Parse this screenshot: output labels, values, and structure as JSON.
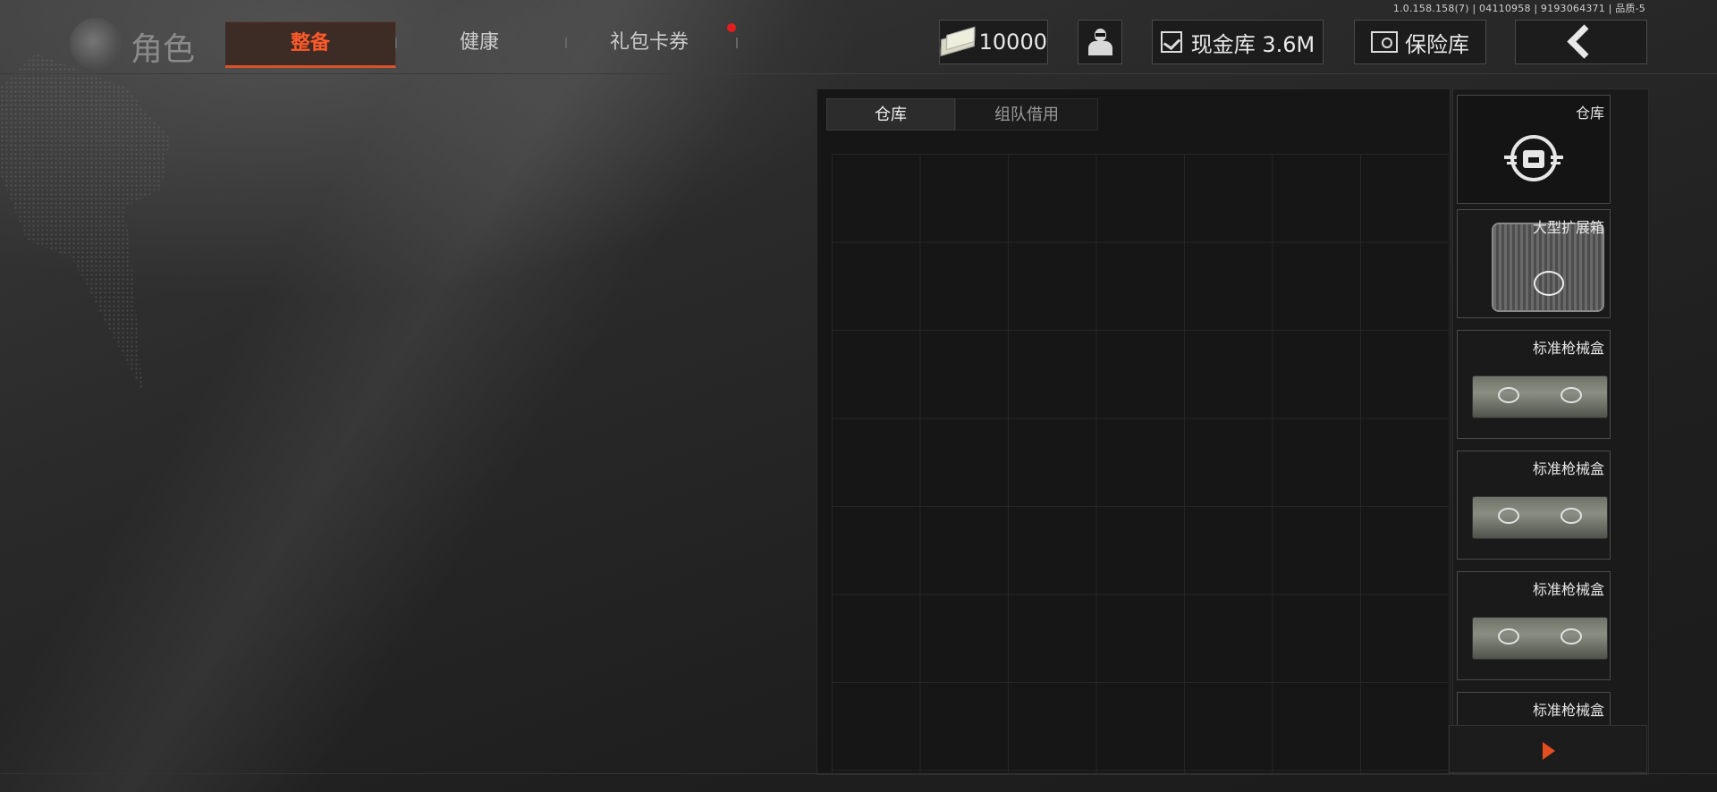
{
  "version_text": "1.0.158.158(7) | 04110958 | 9193064371 | 品质-5",
  "header": {
    "title": "角色",
    "tabs": [
      {
        "label": "整备",
        "active": true
      },
      {
        "label": "健康",
        "active": false
      },
      {
        "label": "礼包卡券",
        "active": false,
        "notification": true
      }
    ],
    "money": "10000",
    "cash_vault": "现金库 3.6M",
    "safe": "保险库",
    "icons": {
      "money": "banknote-icon",
      "agent": "agent-icon",
      "cash": "chart-icon",
      "safe": "safe-icon",
      "back": "back-chevron-icon"
    }
  },
  "storage": {
    "tabs": [
      {
        "label": "仓库",
        "active": true
      },
      {
        "label": "组队借用",
        "active": false
      }
    ]
  },
  "sidebar": {
    "items": [
      {
        "label": "仓库"
      },
      {
        "label": "大型扩展箱"
      },
      {
        "label": "标准枪械盒"
      },
      {
        "label": "标准枪械盒"
      },
      {
        "label": "标准枪械盒"
      },
      {
        "label": "标准枪械盒"
      }
    ]
  },
  "colors": {
    "accent": "#ff5a2a",
    "notification": "#e01e1e"
  }
}
